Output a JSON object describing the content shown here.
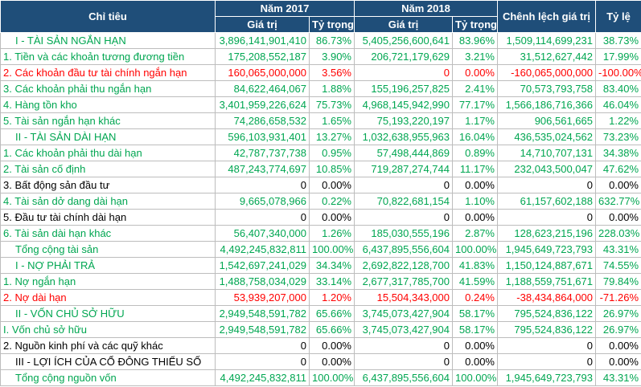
{
  "header": {
    "col_label": "Chỉ tiêu",
    "year_a": "Năm 2017",
    "year_b": "Năm 2018",
    "diff": "Chênh lệch giá trị",
    "rate": "Tỷ lệ",
    "value": "Giá trị",
    "share": "Tỷ trọng"
  },
  "colors": {
    "header_bg": "#1f4e79",
    "green": "#00a651",
    "red": "#ff0000",
    "black": "#000000"
  },
  "rows": [
    {
      "label": "I - TÀI SẢN NGẮN HẠN",
      "v17": "3,896,141,901,410",
      "s17": "86.73%",
      "v18": "5,405,256,600,641",
      "s18": "83.96%",
      "diff": "1,509,114,699,231",
      "rate": "38.73%",
      "color": "green",
      "section": true
    },
    {
      "label": "1. Tiền và các khoản tương đương tiền",
      "v17": "175,208,552,187",
      "s17": "3.90%",
      "v18": "206,721,179,629",
      "s18": "3.21%",
      "diff": "31,512,627,442",
      "rate": "17.99%",
      "color": "green",
      "section": false
    },
    {
      "label": "2. Các khoản đầu tư tài chính ngắn hạn",
      "v17": "160,065,000,000",
      "s17": "3.56%",
      "v18": "0",
      "s18": "0.00%",
      "diff": "-160,065,000,000",
      "rate": "-100.00%",
      "color": "red",
      "section": false
    },
    {
      "label": "3. Các khoản phải thu ngắn hạn",
      "v17": "84,622,464,067",
      "s17": "1.88%",
      "v18": "155,196,257,825",
      "s18": "2.41%",
      "diff": "70,573,793,758",
      "rate": "83.40%",
      "color": "green",
      "section": false
    },
    {
      "label": "4. Hàng tồn kho",
      "v17": "3,401,959,226,624",
      "s17": "75.73%",
      "v18": "4,968,145,942,990",
      "s18": "77.17%",
      "diff": "1,566,186,716,366",
      "rate": "46.04%",
      "color": "green",
      "section": false
    },
    {
      "label": "5. Tài sản ngắn hạn khác",
      "v17": "74,286,658,532",
      "s17": "1.65%",
      "v18": "75,193,220,197",
      "s18": "1.17%",
      "diff": "906,561,665",
      "rate": "1.22%",
      "color": "green",
      "section": false
    },
    {
      "label": "II - TÀI SẢN DÀI HẠN",
      "v17": "596,103,931,401",
      "s17": "13.27%",
      "v18": "1,032,638,955,963",
      "s18": "16.04%",
      "diff": "436,535,024,562",
      "rate": "73.23%",
      "color": "green",
      "section": true
    },
    {
      "label": "1. Các khoản phải thu dài hạn",
      "v17": "42,787,737,738",
      "s17": "0.95%",
      "v18": "57,498,444,869",
      "s18": "0.89%",
      "diff": "14,710,707,131",
      "rate": "34.38%",
      "color": "green",
      "section": false
    },
    {
      "label": "2. Tài sản cố định",
      "v17": "487,243,774,697",
      "s17": "10.85%",
      "v18": "719,287,274,744",
      "s18": "11.17%",
      "diff": "232,043,500,047",
      "rate": "47.62%",
      "color": "green",
      "section": false
    },
    {
      "label": "3. Bất động sản đầu tư",
      "v17": "0",
      "s17": "0.00%",
      "v18": "0",
      "s18": "0.00%",
      "diff": "0",
      "rate": "0.00%",
      "color": "black",
      "section": false
    },
    {
      "label": "4. Tài sản dở dang dài hạn",
      "v17": "9,665,078,966",
      "s17": "0.22%",
      "v18": "70,822,681,154",
      "s18": "1.10%",
      "diff": "61,157,602,188",
      "rate": "632.77%",
      "color": "green",
      "section": false
    },
    {
      "label": "5. Đầu tư tài chính dài hạn",
      "v17": "0",
      "s17": "0.00%",
      "v18": "0",
      "s18": "0.00%",
      "diff": "0",
      "rate": "0.00%",
      "color": "black",
      "section": false
    },
    {
      "label": "6. Tài sản dài hạn khác",
      "v17": "56,407,340,000",
      "s17": "1.26%",
      "v18": "185,030,555,196",
      "s18": "2.87%",
      "diff": "128,623,215,196",
      "rate": "228.03%",
      "color": "green",
      "section": false
    },
    {
      "label": "Tổng cộng tài sản",
      "v17": "4,492,245,832,811",
      "s17": "100.00%",
      "v18": "6,437,895,556,604",
      "s18": "100.00%",
      "diff": "1,945,649,723,793",
      "rate": "43.31%",
      "color": "green",
      "section": true
    },
    {
      "label": "I - NỢ PHẢI TRẢ",
      "v17": "1,542,697,241,029",
      "s17": "34.34%",
      "v18": "2,692,822,128,700",
      "s18": "41.83%",
      "diff": "1,150,124,887,671",
      "rate": "74.55%",
      "color": "green",
      "section": true
    },
    {
      "label": "1. Nợ ngắn hạn",
      "v17": "1,488,758,034,029",
      "s17": "33.14%",
      "v18": "2,677,317,785,700",
      "s18": "41.59%",
      "diff": "1,188,559,751,671",
      "rate": "79.84%",
      "color": "green",
      "section": false
    },
    {
      "label": "2. Nợ dài hạn",
      "v17": "53,939,207,000",
      "s17": "1.20%",
      "v18": "15,504,343,000",
      "s18": "0.24%",
      "diff": "-38,434,864,000",
      "rate": "-71.26%",
      "color": "red",
      "section": false
    },
    {
      "label": "II - VỐN CHỦ SỞ HỮU",
      "v17": "2,949,548,591,782",
      "s17": "65.66%",
      "v18": "3,745,073,427,904",
      "s18": "58.17%",
      "diff": "795,524,836,122",
      "rate": "26.97%",
      "color": "green",
      "section": true
    },
    {
      "label": "I. Vốn chủ sở hữu",
      "v17": "2,949,548,591,782",
      "s17": "65.66%",
      "v18": "3,745,073,427,904",
      "s18": "58.17%",
      "diff": "795,524,836,122",
      "rate": "26.97%",
      "color": "green",
      "section": false
    },
    {
      "label": "2. Nguồn kinh phí và các quỹ khác",
      "v17": "0",
      "s17": "0.00%",
      "v18": "0",
      "s18": "0.00%",
      "diff": "0",
      "rate": "0.00%",
      "color": "black",
      "section": false
    },
    {
      "label": "III - LỢI ÍCH CỦA CỔ ĐÔNG THIỂU SỐ",
      "v17": "0",
      "s17": "0.00%",
      "v18": "0",
      "s18": "0.00%",
      "diff": "0",
      "rate": "0.00%",
      "color": "black",
      "section": true
    },
    {
      "label": "Tổng cộng nguồn vốn",
      "v17": "4,492,245,832,811",
      "s17": "100.00%",
      "v18": "6,437,895,556,604",
      "s18": "100.00%",
      "diff": "1,945,649,723,793",
      "rate": "43.31%",
      "color": "green",
      "section": true
    }
  ]
}
